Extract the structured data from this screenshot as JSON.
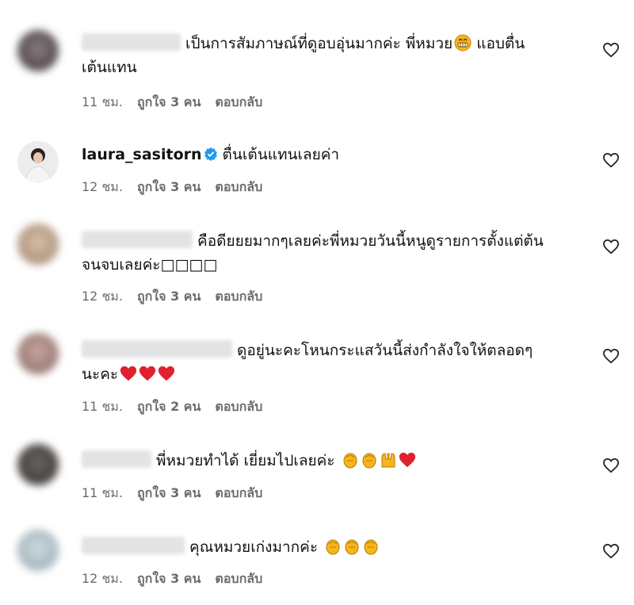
{
  "comments": [
    {
      "text_line1": "เป็นการสัมภาษณ์ที่ดูอบอุ่นมากค่ะ พี่หมวย",
      "text_after_emoji": " แอบตื่น",
      "text_line2": "เต้นแทน",
      "time": "11 ชม.",
      "likes": "ถูกใจ 3 คน",
      "reply": "ตอบกลับ"
    },
    {
      "username": "laura_sasitorn",
      "text": "ตื่นเต้นแทนเลยค่า",
      "time": "12 ชม.",
      "likes": "ถูกใจ 3 คน",
      "reply": "ตอบกลับ"
    },
    {
      "text_line1": "คือดียยยมากๆเลยค่ะพี่หมวยวันนี้หนูดูรายการตั้งแต่ต้น",
      "text_line2": "จนจบเลยค่ะ□□□□",
      "time": "12 ชม.",
      "likes": "ถูกใจ 3 คน",
      "reply": "ตอบกลับ"
    },
    {
      "text_line1": "ดูอยู่นะคะโหนกระแสวันนี้ส่งกำลังใจให้ตลอดๆ",
      "text_line2": "นะคะ",
      "time": "11 ชม.",
      "likes": "ถูกใจ 2 คน",
      "reply": "ตอบกลับ"
    },
    {
      "text_line1": "พี่หมวยทำได้ เยี่ยมไปเลยค่ะ ",
      "time": "11 ชม.",
      "likes": "ถูกใจ 3 คน",
      "reply": "ตอบกลับ"
    },
    {
      "text_line1": "คุณหมวยเก่งมากค่ะ ",
      "time": "12 ชม.",
      "likes": "ถูกใจ 3 คน",
      "reply": "ตอบกลับ"
    }
  ],
  "icons": {
    "like": "heart-outline-icon",
    "verified": "verified-badge-icon"
  },
  "colors": {
    "verified_blue": "#1d9bf0",
    "meta_gray": "#6b6b6b",
    "heart_red": "#e0202e",
    "clap_yellow": "#f7b51c"
  }
}
